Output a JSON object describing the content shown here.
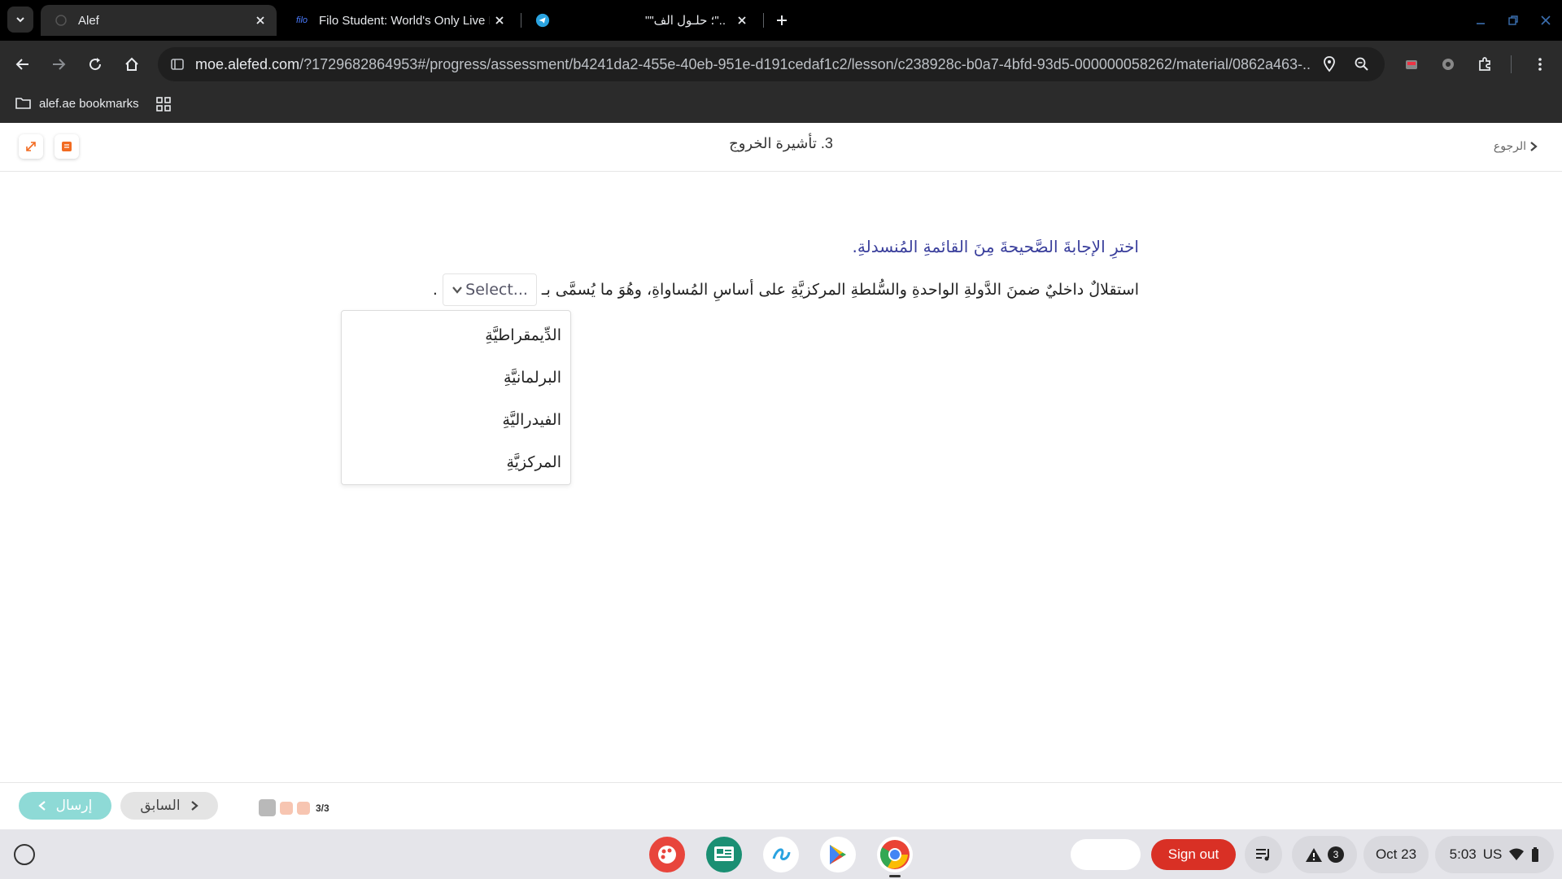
{
  "browser": {
    "tabs": [
      {
        "title": "Alef",
        "active": true
      },
      {
        "title": "Filo Student: World's Only Live I",
        "favicon_text": "filo",
        "active": false
      },
      {
        "title": "\"\"؛ حلـول الف\"..",
        "active": false
      }
    ],
    "url_host": "moe.alefed.com",
    "url_path": "/?1729682864953#/progress/assessment/b4241da2-455e-40eb-951e-d191cedaf1c2/lesson/c238928c-b0a7-4bfd-93d5-000000058262/material/0862a463-...",
    "bookmarks": [
      {
        "label": "alef.ae bookmarks"
      }
    ]
  },
  "lesson": {
    "title": "3. تأشيرة الخروج",
    "back_label": "الرجوع"
  },
  "question": {
    "instruction": "اخترِ الإجابةَ الصَّحيحةَ مِنَ القائمةِ المُنسدلةِ.",
    "text_before": "استقلالٌ داخليٌ ضمنَ الدَّولةِ الواحدةِ والسُّلطةِ المركزيَّةِ على أساسِ المُساواةِ، وهُوَ ما يُسمَّى بـ",
    "text_after": ".",
    "select_placeholder": "Select...",
    "options": [
      "الدِّيمقراطيَّةِ",
      "البرلمانيَّةِ",
      "الفيدراليَّةِ",
      "المركزيَّةِ"
    ]
  },
  "footer": {
    "submit_label": "إرسال",
    "prev_label": "السابق",
    "progress_text": "3/3",
    "progress_current": 3,
    "progress_total": 3
  },
  "shelf": {
    "signout_label": "Sign out",
    "notification_count": "3",
    "date": "Oct 23",
    "time": "5:03",
    "locale": "US",
    "apps": [
      "paint-app",
      "classroom-app",
      "cursive-app",
      "play-store-app",
      "chrome-app"
    ]
  },
  "colors": {
    "accent_blue": "#3a3f9c",
    "submit_teal": "#8edad6",
    "signout_red": "#d93025",
    "progress_peach": "#f7c5b1"
  }
}
